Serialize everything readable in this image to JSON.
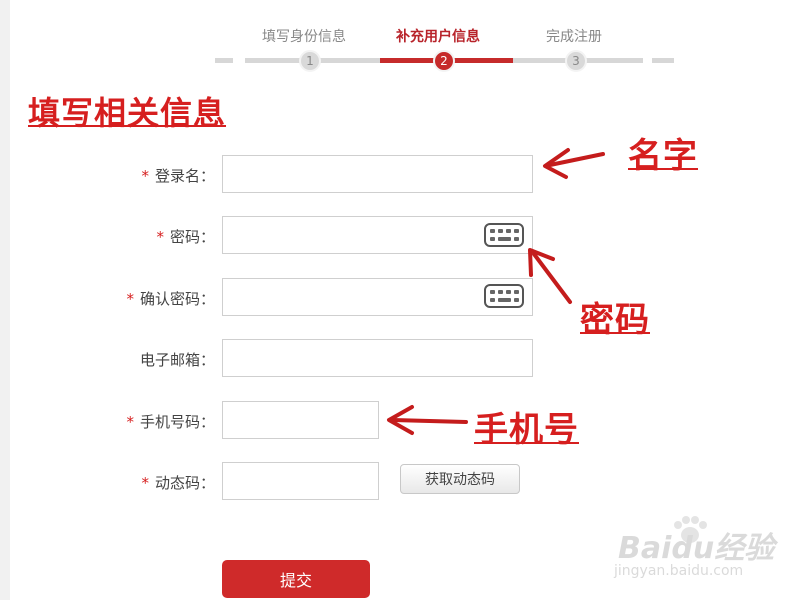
{
  "steps": {
    "items": [
      {
        "label": "填写身份信息",
        "number": "1",
        "active": false
      },
      {
        "label": "补充用户信息",
        "number": "2",
        "active": true
      },
      {
        "label": "完成注册",
        "number": "3",
        "active": false
      }
    ]
  },
  "heading": "填写相关信息",
  "form": {
    "required_mark": "*",
    "login_name": {
      "label": "登录名：",
      "value": ""
    },
    "password": {
      "label": "密码：",
      "value": ""
    },
    "confirm_password": {
      "label": "确认密码：",
      "value": ""
    },
    "email": {
      "label": "电子邮箱：",
      "value": ""
    },
    "phone": {
      "label": "手机号码：",
      "value": ""
    },
    "code": {
      "label": "动态码：",
      "value": ""
    },
    "get_code_button": "获取动态码",
    "submit_button": "提交"
  },
  "annotations": {
    "name": "名字",
    "password": "密码",
    "phone": "手机号"
  },
  "watermark": {
    "logo": "Baidu经验",
    "url": "jingyan.baidu.com"
  },
  "colors": {
    "accent": "#c62b2b",
    "annotation": "#d61f1f"
  },
  "icons": [
    "keyboard-icon",
    "arrow-icon",
    "baidu-paw-icon"
  ]
}
